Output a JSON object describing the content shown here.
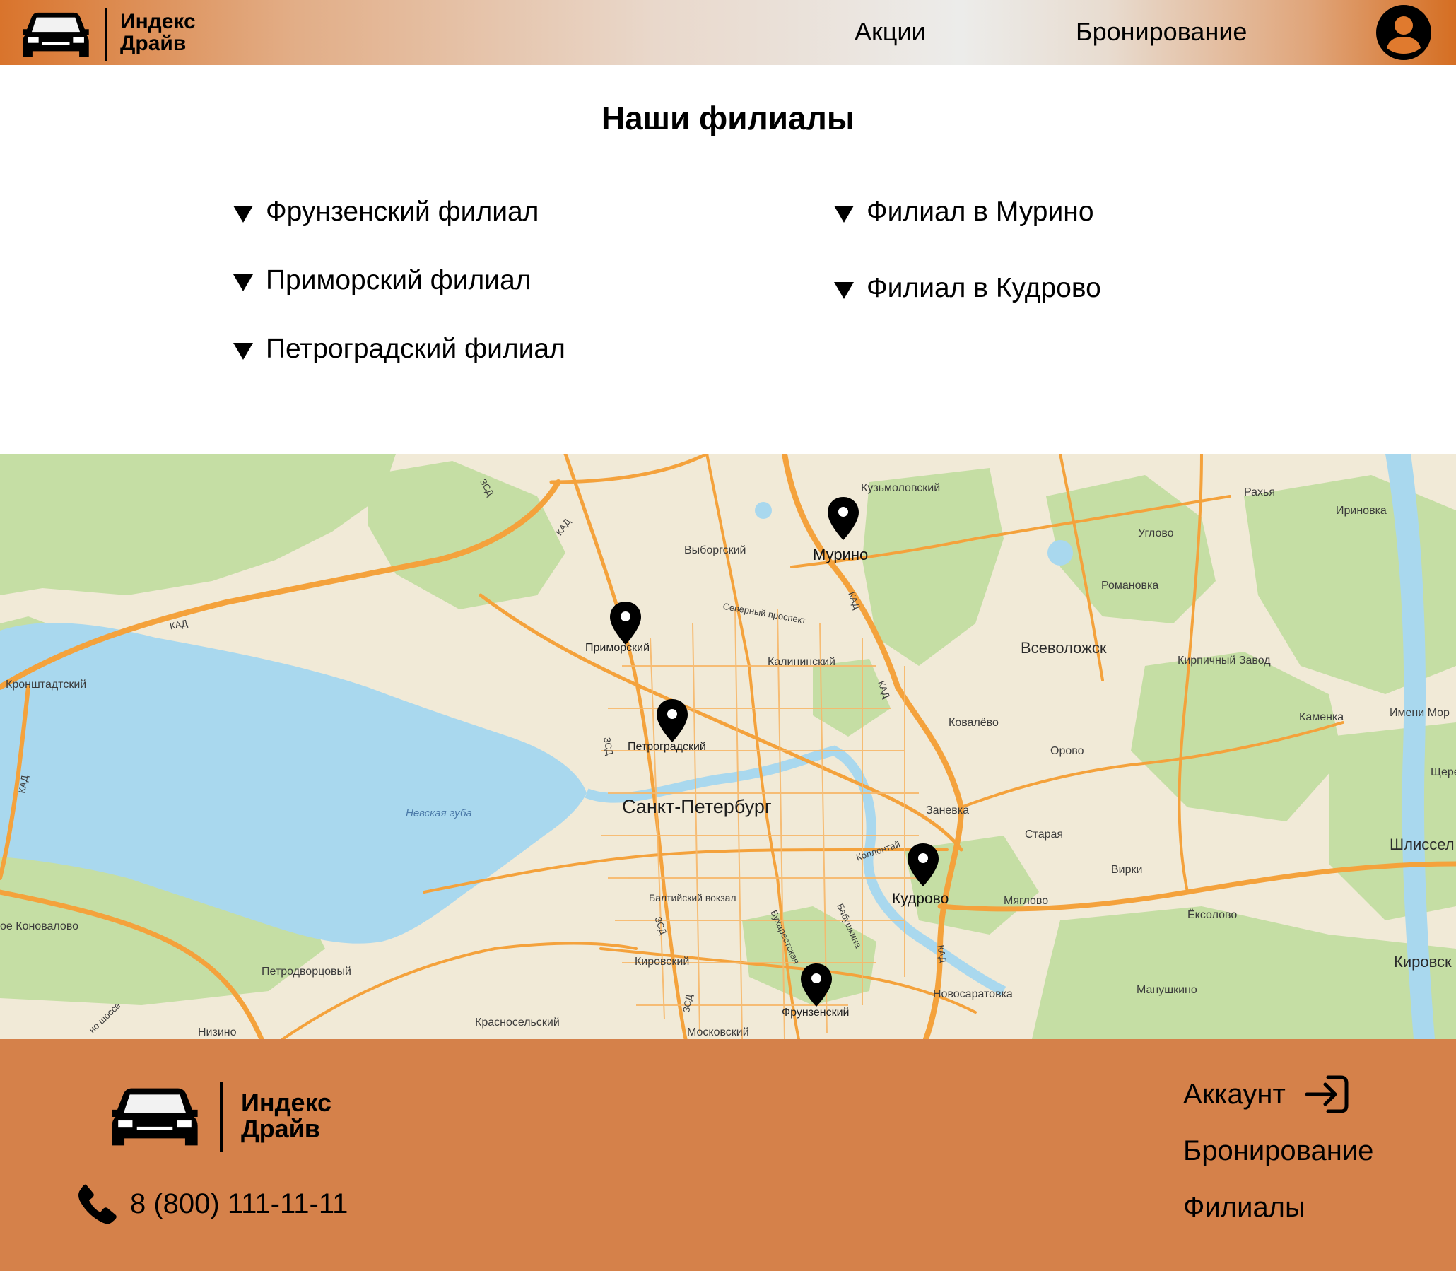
{
  "colors": {
    "accent_orange": "#d5814a",
    "header_orange": "#d9742c",
    "map_land": "#f1ead7",
    "map_water": "#a9d8ee",
    "map_forest": "#c5dea4",
    "map_road": "#f4a23c",
    "text": "#000000"
  },
  "header": {
    "brand_line1": "Индекс",
    "brand_line2": "Драйв",
    "logo_icon": "car-icon",
    "nav": [
      "Акции",
      "Бронирование"
    ],
    "user_icon": "user-account-icon"
  },
  "branches": {
    "title": "Наши филиалы",
    "left": [
      "Фрунзенский филиал",
      "Приморский филиал",
      "Петроградский филиал"
    ],
    "right": [
      "Филиал в Мурино",
      "Филиал в Кудрово"
    ],
    "toggle_icon": "triangle-down-icon"
  },
  "map": {
    "city": "Санкт-Петербург",
    "water": "Невская губа",
    "pins": [
      "Мурино",
      "Приморский",
      "Петроградский",
      "Кудрово",
      "Фрунзенский"
    ],
    "places": [
      "Кузьмоловский",
      "Рахья",
      "Ириновка",
      "Углово",
      "Выборгский",
      "Романовка",
      "Северный проспект",
      "Калининский",
      "Всеволожск",
      "Кирпичный Завод",
      "Кронштадтский",
      "Ковалёво",
      "Каменка",
      "Имени Мор",
      "Орово",
      "Щере",
      "Заневка",
      "Старая",
      "Шлиссел",
      "Коллонтай",
      "Вирки",
      "Балтийский вокзал",
      "Мяглово",
      "Ёксолово",
      "ое Коновалово",
      "Петродворцовый",
      "Кировский",
      "Бухарестская",
      "Бабушкина",
      "Кировск",
      "Новосаратовка",
      "Манушкино",
      "Красносельский",
      "Московский",
      "Низино",
      "но шоссе"
    ],
    "roads": [
      "КАД",
      "ЗСД"
    ]
  },
  "footer": {
    "brand_line1": "Индекс",
    "brand_line2": "Драйв",
    "phone": "8 (800) 111-11-11",
    "phone_icon": "phone-icon",
    "account": "Аккаунт",
    "login_icon": "login-arrow-icon",
    "booking": "Бронирование",
    "branches": "Филиалы"
  }
}
